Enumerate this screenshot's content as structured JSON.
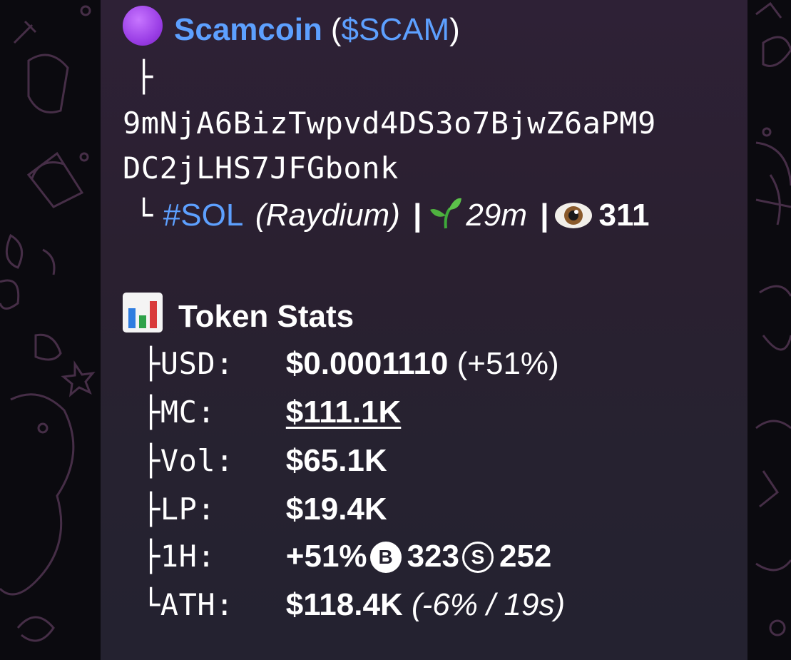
{
  "token": {
    "name": "Scamcoin",
    "ticker_open": "(",
    "ticker": "$SCAM",
    "ticker_close": ")",
    "branch_top": "├",
    "address_line1": "9mNjA6BizTwpvd4DS3o7BjwZ6aPM9",
    "address_line2": "DC2jLHS7JFGbonk",
    "branch_end": "└",
    "chain": "#SOL",
    "dex": "(Raydium)",
    "sep": "|",
    "age": "29m",
    "views": "311"
  },
  "stats": {
    "title": "Token Stats",
    "rows": [
      {
        "branch": "├",
        "label": "USD:",
        "value": "$0.0001110",
        "extra": "(+51%)"
      },
      {
        "branch": "├",
        "label": "MC:",
        "value": "$111.1K"
      },
      {
        "branch": "├",
        "label": "Vol:",
        "value": "$65.1K"
      },
      {
        "branch": "├",
        "label": "LP:",
        "value": "$19.4K"
      },
      {
        "branch": "├",
        "label": "1H:",
        "value": "+51%",
        "buy_icon": "B",
        "buys": "323",
        "sell_icon": "S",
        "sells": "252"
      },
      {
        "branch": "└",
        "label": "ATH:",
        "value": "$118.4K",
        "extra": "(-6% / 19s)"
      }
    ]
  },
  "icons": {
    "token": "purple-circle-icon",
    "chart": "bar-chart-icon",
    "age": "seedling-icon",
    "views": "eye-icon"
  },
  "colors": {
    "link": "#5da0ff",
    "bubble": "#2a2030",
    "background": "#0b0a0f"
  }
}
